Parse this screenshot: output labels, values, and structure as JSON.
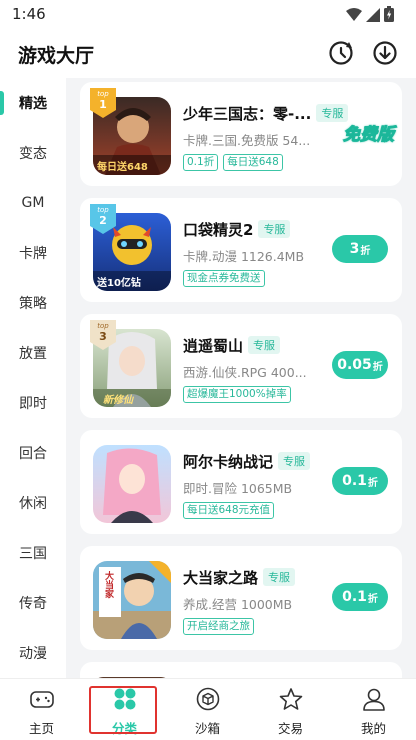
{
  "status": {
    "time": "1:46"
  },
  "header": {
    "title": "游戏大厅"
  },
  "sidebar": {
    "items": [
      {
        "label": "精选",
        "active": true
      },
      {
        "label": "变态"
      },
      {
        "label": "GM"
      },
      {
        "label": "卡牌"
      },
      {
        "label": "策略"
      },
      {
        "label": "放置"
      },
      {
        "label": "即时"
      },
      {
        "label": "回合"
      },
      {
        "label": "休闲"
      },
      {
        "label": "三国"
      },
      {
        "label": "传奇"
      },
      {
        "label": "动漫"
      }
    ]
  },
  "games": [
    {
      "name": "少年三国志：零-...",
      "exclusive": "专服",
      "meta": "卡牌.三国.免费版 54...",
      "tags": [
        "0.1折",
        "每日送648"
      ],
      "action": "免费版",
      "rank": "1",
      "icon_caption": "每日送648"
    },
    {
      "name": "口袋精灵2",
      "exclusive": "专服",
      "meta": "卡牌.动漫 1126.4MB",
      "tags": [
        "现金点券免费送"
      ],
      "discount": "3",
      "unit": "折",
      "rank": "2",
      "icon_caption": "送10亿钻"
    },
    {
      "name": "逍遥蜀山",
      "exclusive": "专服",
      "meta": "西游.仙侠.RPG 400...",
      "tags": [
        "超爆魔王1000%掉率"
      ],
      "discount": "0.05",
      "unit": "折",
      "rank": "3",
      "icon_caption": "新修仙"
    },
    {
      "name": "阿尔卡纳战记",
      "exclusive": "专服",
      "meta": "即时.冒险 1065MB",
      "tags": [
        "每日送648元充值"
      ],
      "discount": "0.1",
      "unit": "折"
    },
    {
      "name": "大当家之路",
      "exclusive": "专服",
      "meta": "养成.经营 1000MB",
      "tags": [
        "开启经商之旅"
      ],
      "discount": "0.1",
      "unit": "折",
      "icon_caption": "大当家"
    }
  ],
  "rank_badge_text": "top",
  "bottom_nav": [
    {
      "label": "主页"
    },
    {
      "label": "分类",
      "active": true
    },
    {
      "label": "沙箱"
    },
    {
      "label": "交易"
    },
    {
      "label": "我的"
    }
  ],
  "colors": {
    "accent": "#2ac8a8",
    "highlight": "#e0332f"
  }
}
